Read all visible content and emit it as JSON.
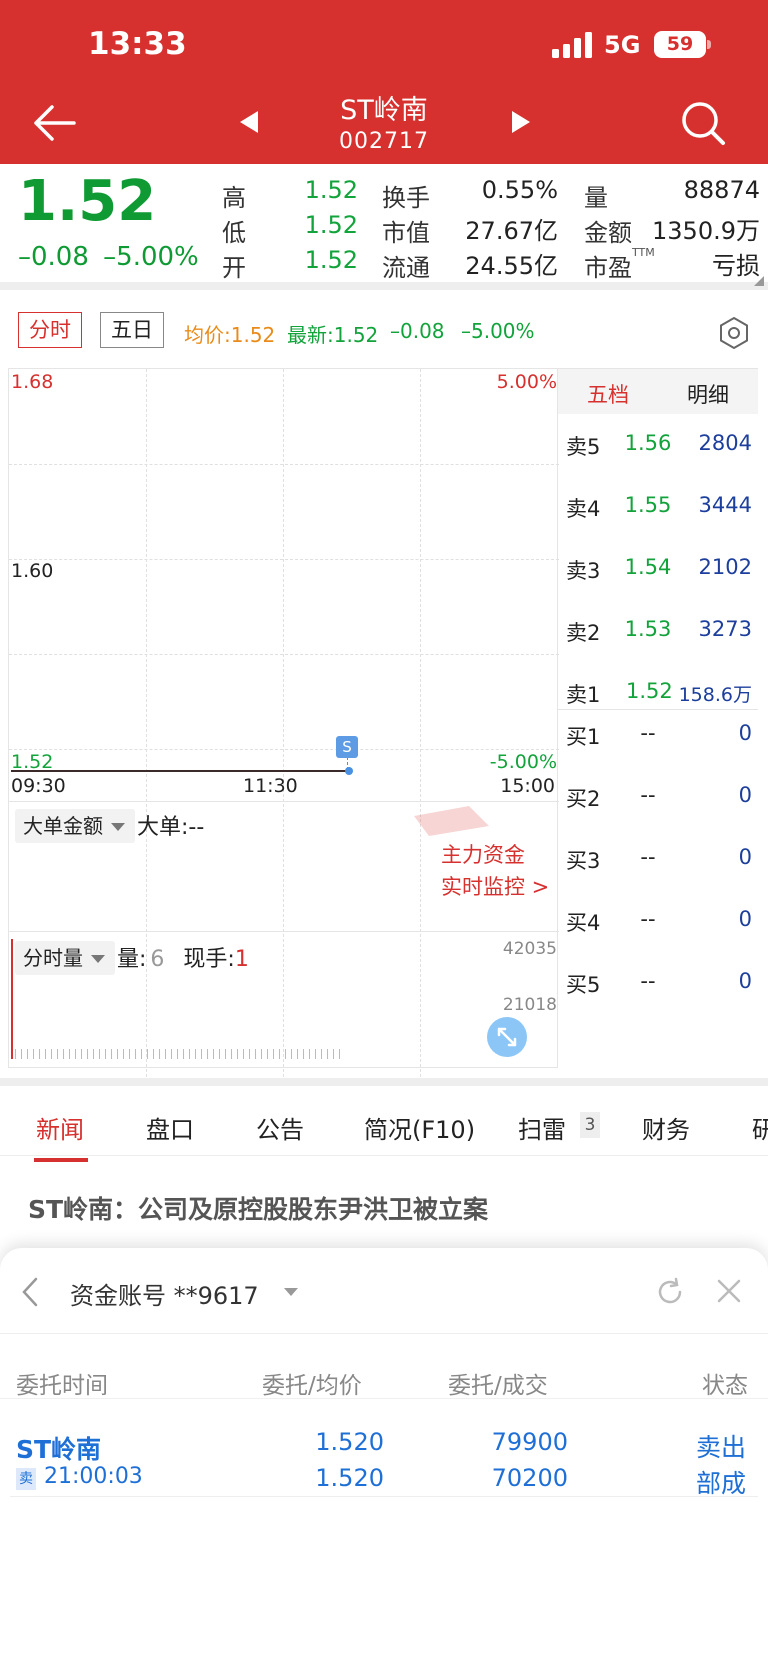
{
  "status": {
    "time": "13:33",
    "network": "5G",
    "battery": "59"
  },
  "header": {
    "title": "ST岭南",
    "code": "002717"
  },
  "quote": {
    "price": "1.52",
    "change": "–0.08",
    "change_pct": "–5.00%",
    "stats": [
      {
        "label": "高",
        "value": "1.52"
      },
      {
        "label": "低",
        "value": "1.52"
      },
      {
        "label": "开",
        "value": "1.52"
      },
      {
        "label": "换手",
        "value": "0.55%"
      },
      {
        "label": "市值",
        "value": "27.67亿"
      },
      {
        "label": "流通",
        "value": "24.55亿"
      },
      {
        "label": "量",
        "value": "88874"
      },
      {
        "label": "金额",
        "value": "1350.9万"
      },
      {
        "label": "市盈",
        "sup": "TTM",
        "value": "亏损"
      }
    ]
  },
  "chart_bar": {
    "tabs": [
      "分时",
      "五日"
    ],
    "avg": "均价:1.52",
    "latest": "最新:1.52",
    "change": "–0.08",
    "pct": "–5.00%"
  },
  "chart": {
    "y_top": "1.68",
    "y_mid": "1.60",
    "y_bottom": "1.52",
    "pct_top": "5.00%",
    "pct_bottom": "-5.00%",
    "x_ticks": [
      "09:30",
      "11:30",
      "15:00"
    ],
    "marker": "S",
    "big_order_dropdown": "大单金额",
    "big_order_text": "大单:--",
    "promo_line1": "主力资金",
    "promo_line2": "实时监控 >",
    "vol_dropdown": "分时量",
    "vol_label": "量:",
    "vol_value": "6",
    "hand_label": "现手:",
    "hand_value": "1",
    "vol_max": "42035",
    "vol_mid": "21018"
  },
  "book": {
    "tabs": [
      "五档",
      "明细"
    ],
    "rows": [
      {
        "label": "卖5",
        "price": "1.56",
        "vol": "2804"
      },
      {
        "label": "卖4",
        "price": "1.55",
        "vol": "3444"
      },
      {
        "label": "卖3",
        "price": "1.54",
        "vol": "2102"
      },
      {
        "label": "卖2",
        "price": "1.53",
        "vol": "3273"
      },
      {
        "label": "卖1",
        "price": "1.52",
        "vol": "158.6万"
      },
      {
        "label": "买1",
        "price": "--",
        "vol": "0"
      },
      {
        "label": "买2",
        "price": "--",
        "vol": "0"
      },
      {
        "label": "买3",
        "price": "--",
        "vol": "0"
      },
      {
        "label": "买4",
        "price": "--",
        "vol": "0"
      },
      {
        "label": "买5",
        "price": "--",
        "vol": "0"
      }
    ]
  },
  "news_tabs": [
    "新闻",
    "盘口",
    "公告",
    "简况(F10)",
    "扫雷",
    "财务",
    "研"
  ],
  "news_badge": "3",
  "headline": "ST岭南：公司及原控股股东尹洪卫被立案",
  "sheet": {
    "account": "资金账号 **9617",
    "columns": [
      "委托时间",
      "委托/均价",
      "委托/成交",
      "状态"
    ],
    "order": {
      "name": "ST岭南",
      "side": "卖",
      "time": "21:00:03",
      "price1": "1.520",
      "price2": "1.520",
      "qty1": "79900",
      "qty2": "70200",
      "status1": "卖出",
      "status2": "部成"
    }
  }
}
